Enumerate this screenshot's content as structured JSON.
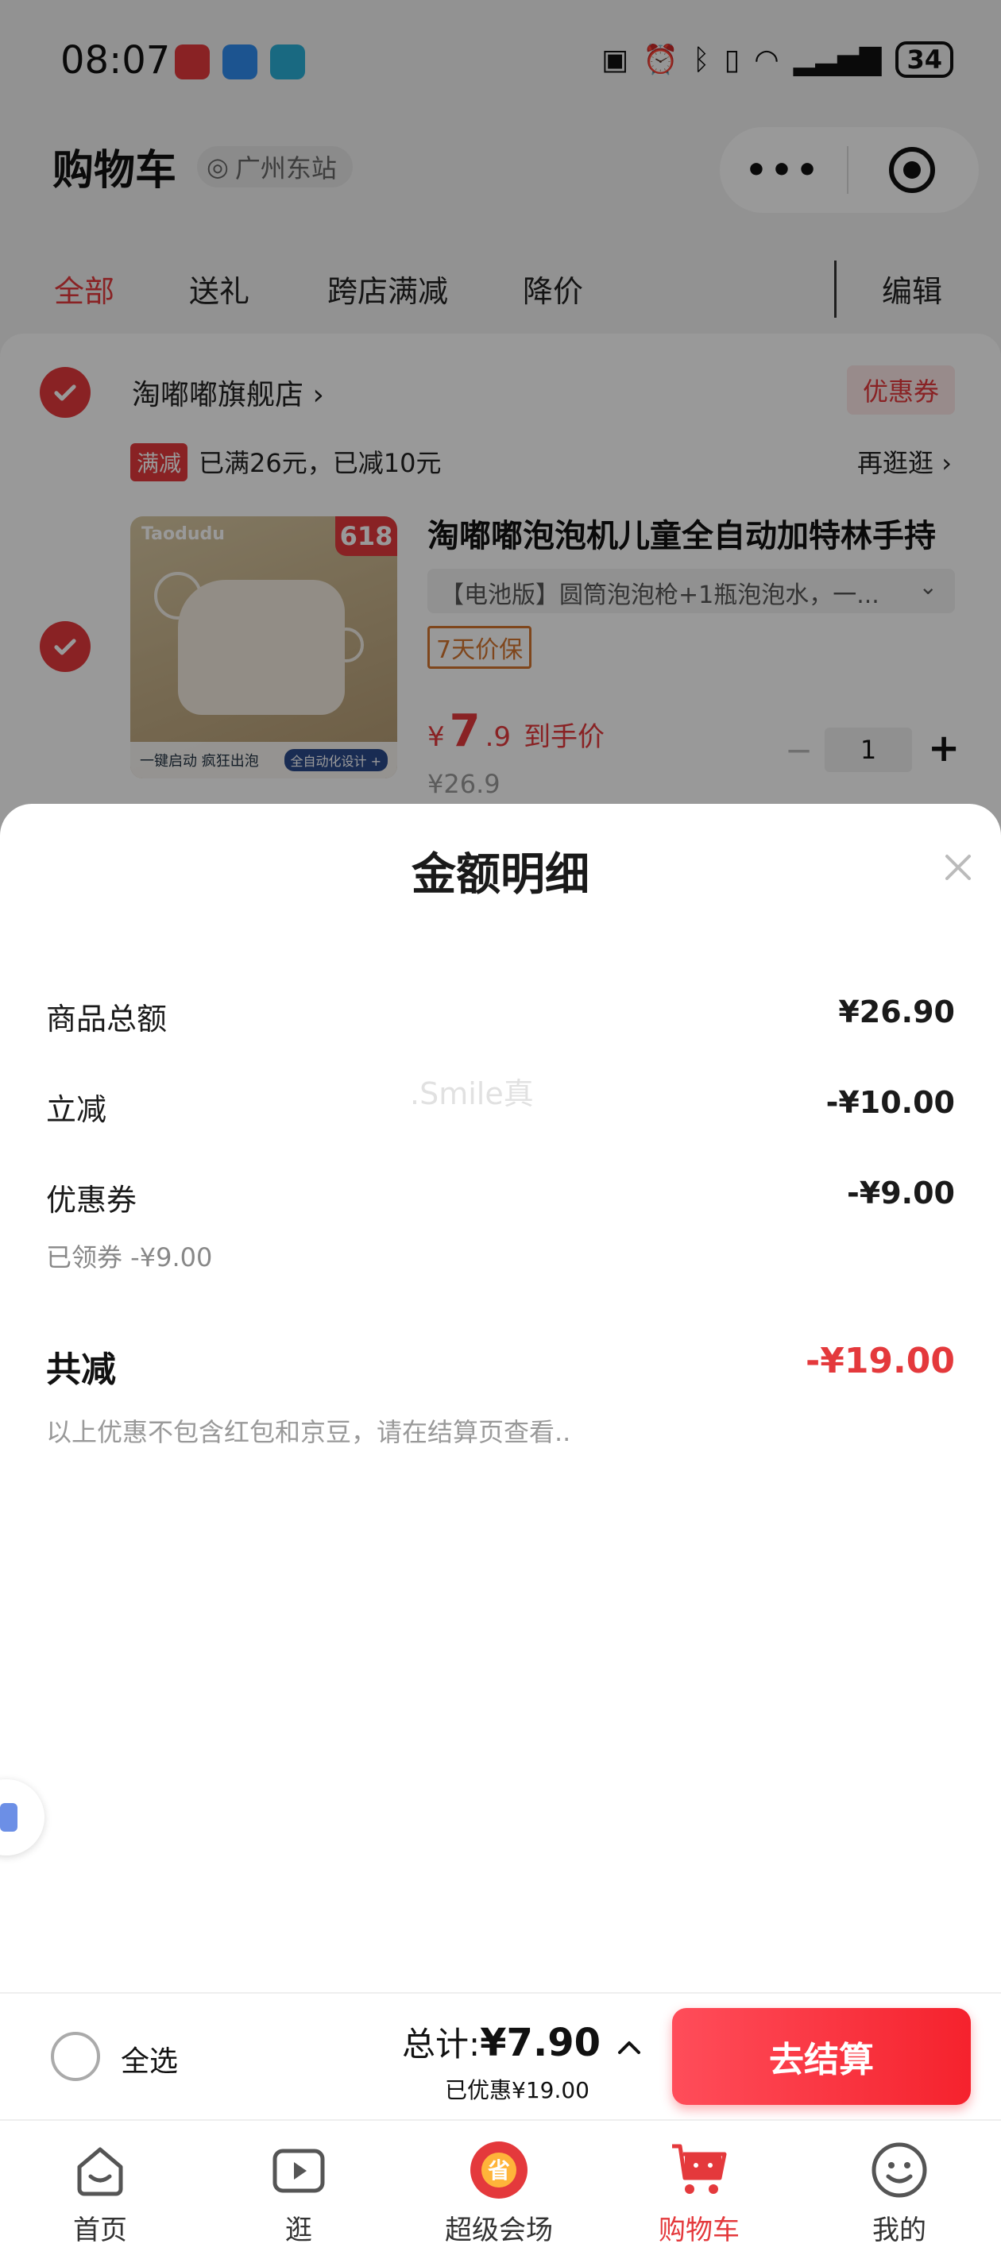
{
  "status_bar": {
    "time": "08:07",
    "battery": "34"
  },
  "header": {
    "title": "购物车",
    "location": "广州东站",
    "capsule_more": "•••"
  },
  "tabs": [
    {
      "label": "全部",
      "active": true
    },
    {
      "label": "送礼",
      "active": false
    },
    {
      "label": "跨店满减",
      "active": false
    },
    {
      "label": "降价",
      "active": false
    }
  ],
  "edit_label": "编辑",
  "store": {
    "name": "淘嘟嘟旗舰店 ›",
    "coupon_tag": "优惠券",
    "promo_badge": "满减",
    "promo_text": "已满26元，已减10元",
    "promo_more": "再逛逛 ›"
  },
  "product": {
    "image_logo": "Taodudu",
    "image_tag": "618",
    "image_caption": "一键启动 疯狂出泡",
    "image_pill": "全自动化设计 +",
    "title": "淘嘟嘟泡泡机儿童全自动加特林手持",
    "spec": "【电池版】圆筒泡泡枪+1瓶泡泡水，一...",
    "guarantee": "7天价保",
    "price_symbol": "¥",
    "price_int": "7",
    "price_dec": ".9",
    "price_suffix": "到手价",
    "original_price": "¥26.9",
    "quantity": "1"
  },
  "sheet": {
    "title": "金额明细",
    "rows": [
      {
        "label": "商品总额",
        "value": "¥26.90"
      },
      {
        "label": "立减",
        "value": "-¥10.00"
      },
      {
        "label": "优惠券",
        "value": "-¥9.00",
        "sub": "已领券 -¥9.00"
      }
    ],
    "total_label": "共减",
    "total_value": "-¥19.00",
    "note": "以上优惠不包含红包和京豆，请在结算页查看..",
    "watermark": ".Smile真"
  },
  "checkout": {
    "select_all": "全选",
    "total_prefix": "总计:",
    "total_amount": "¥7.90",
    "saved": "已优惠¥19.00",
    "button": "去结算"
  },
  "tabbar": [
    {
      "label": "首页",
      "icon": "home-icon"
    },
    {
      "label": "逛",
      "icon": "video-icon"
    },
    {
      "label": "超级会场",
      "icon": "super-venue-icon"
    },
    {
      "label": "购物车",
      "icon": "cart-icon",
      "active": true
    },
    {
      "label": "我的",
      "icon": "profile-icon"
    }
  ],
  "colors": {
    "accent": "#e4393c",
    "checkout_button": "#f5222d"
  }
}
